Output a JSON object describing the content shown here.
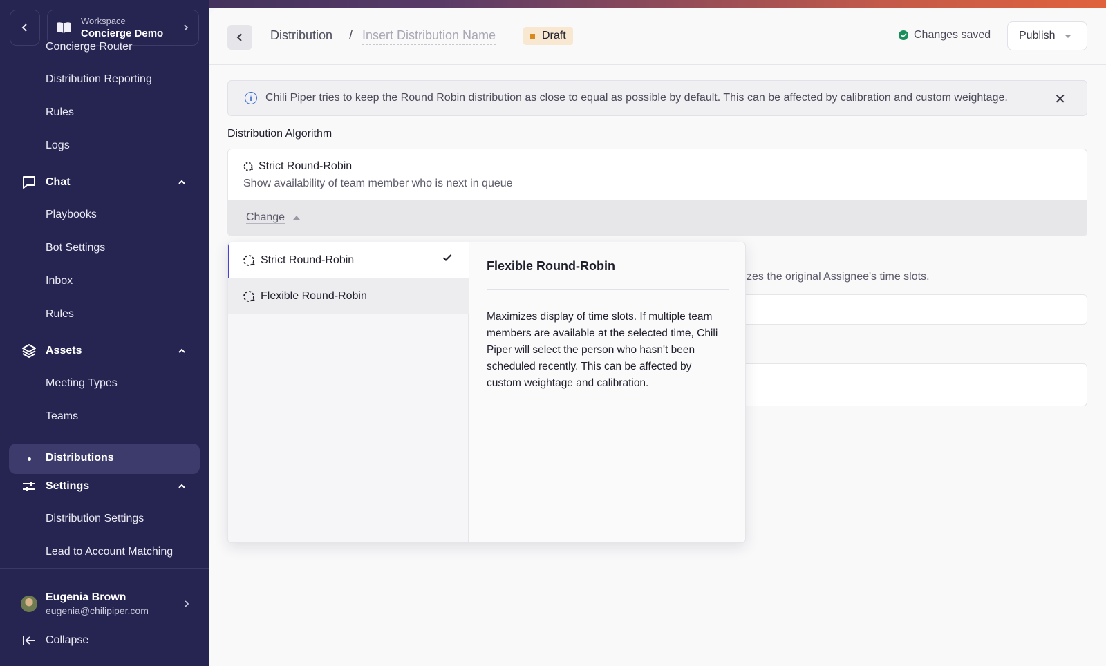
{
  "workspace": {
    "sub_label": "Workspace",
    "name": "Concierge Demo"
  },
  "sidebar": {
    "cut_item": "Concierge Router",
    "items_top": [
      "Distribution Reporting",
      "Rules",
      "Logs"
    ],
    "chat": {
      "label": "Chat",
      "items": [
        "Playbooks",
        "Bot Settings",
        "Inbox",
        "Rules"
      ]
    },
    "assets": {
      "label": "Assets",
      "items": [
        "Meeting Types",
        "Teams"
      ],
      "active": "Distributions"
    },
    "settings": {
      "label": "Settings",
      "items": [
        "Distribution Settings",
        "Lead to Account Matching"
      ]
    },
    "user": {
      "name": "Eugenia Brown",
      "email": "eugenia@chilipiper.com"
    },
    "collapse_label": "Collapse"
  },
  "header": {
    "breadcrumb": "Distribution",
    "separator": "/",
    "name_placeholder": "Insert Distribution Name",
    "status_badge": "Draft",
    "saved_label": "Changes saved",
    "publish_label": "Publish"
  },
  "info_banner": {
    "text": "Chili Piper tries to keep the Round Robin distribution as close to equal as possible by default. This can be affected by calibration and custom weightage."
  },
  "algorithm": {
    "section_label": "Distribution Algorithm",
    "selected_title": "Strict Round-Robin",
    "selected_desc": "Show availability of team member who is next in queue",
    "change_label": "Change"
  },
  "background_text": "zes the original Assignee's time slots.",
  "dropdown": {
    "options": [
      "Strict Round-Robin",
      "Flexible Round-Robin"
    ],
    "detail_title": "Flexible Round-Robin",
    "detail_text": "Maximizes display of time slots. If multiple team members are available at the selected time, Chili Piper will select the person who hasn't been scheduled recently. This can be affected by custom weightage and calibration."
  },
  "colors": {
    "sidebar_bg": "#262551",
    "accent": "#4b3fd9",
    "draft_badge": "#f8e8d2",
    "saved_ok": "#1a8f5a"
  }
}
